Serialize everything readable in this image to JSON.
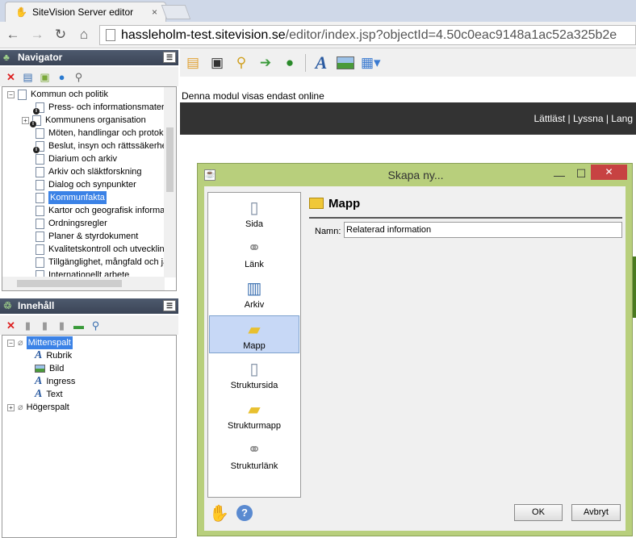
{
  "browser": {
    "tab_title": "SiteVision Server editor",
    "tab_close": "×",
    "url_host": "hassleholm-test.sitevision.se",
    "url_path": "/editor/index.jsp?objectId=4.50c0eac9148a1ac52a325b2e"
  },
  "navigator": {
    "title": "Navigator",
    "items": [
      {
        "label": "Kommun och politik"
      },
      {
        "label": "Press- och informationsmateri"
      },
      {
        "label": "Kommunens organisation"
      },
      {
        "label": "Möten, handlingar och protok"
      },
      {
        "label": "Beslut, insyn och rättssäkerhe"
      },
      {
        "label": "Diarium och arkiv"
      },
      {
        "label": "Arkiv och släktforskning"
      },
      {
        "label": "Dialog och synpunkter"
      },
      {
        "label": "Kommunfakta"
      },
      {
        "label": "Kartor och geografisk informa"
      },
      {
        "label": "Ordningsregler"
      },
      {
        "label": "Planer & styrdokument"
      },
      {
        "label": "Kvalitetskontroll och utvecklin"
      },
      {
        "label": "Tillgänglighet, mångfald och jä"
      },
      {
        "label": "Internationellt arbete"
      }
    ]
  },
  "content": {
    "title": "Innehåll",
    "items": [
      {
        "label": "Mittenspalt"
      },
      {
        "label": "Rubrik"
      },
      {
        "label": "Bild"
      },
      {
        "label": "Ingress"
      },
      {
        "label": "Text"
      },
      {
        "label": "Högerspalt"
      }
    ]
  },
  "editor": {
    "notice": "Denna modul visas endast online",
    "topnav": "Lättläst  |  Lyssna  |  Lang"
  },
  "dialog": {
    "title": "Skapa ny...",
    "section_title": "Mapp",
    "name_label": "Namn:",
    "name_value": "Relaterad information",
    "types": [
      {
        "label": "Sida",
        "icon": "page-icon"
      },
      {
        "label": "Länk",
        "icon": "link-icon"
      },
      {
        "label": "Arkiv",
        "icon": "archive-icon"
      },
      {
        "label": "Mapp",
        "icon": "folder-icon"
      },
      {
        "label": "Struktursida",
        "icon": "structure-page-icon"
      },
      {
        "label": "Strukturmapp",
        "icon": "structure-folder-icon"
      },
      {
        "label": "Strukturlänk",
        "icon": "structure-link-icon"
      }
    ],
    "ok_label": "OK",
    "cancel_label": "Avbryt"
  }
}
